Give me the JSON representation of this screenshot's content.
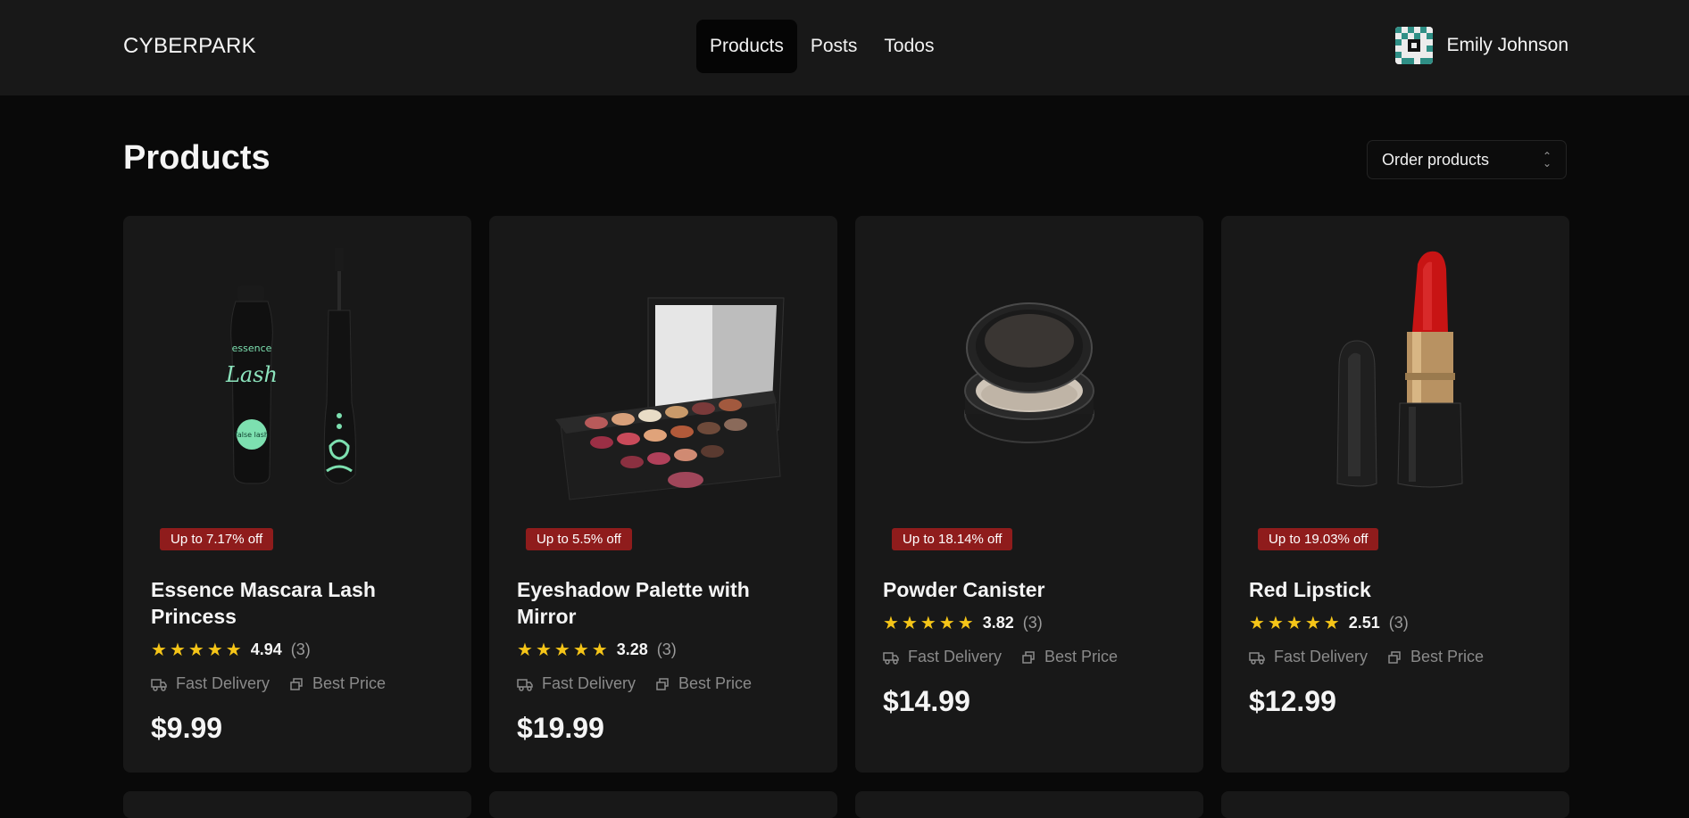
{
  "header": {
    "brand": "CYBERPARK",
    "nav": [
      {
        "label": "Products",
        "active": true
      },
      {
        "label": "Posts",
        "active": false
      },
      {
        "label": "Todos",
        "active": false
      }
    ],
    "user_name": "Emily Johnson"
  },
  "main": {
    "title": "Products",
    "order_select": {
      "label": "Order products"
    }
  },
  "products": [
    {
      "badge": "Up to 7.17% off",
      "title": "Essence Mascara Lash Princess",
      "rating": "4.94",
      "reviews": "(3)",
      "feature1": "Fast Delivery",
      "feature2": "Best Price",
      "price": "$9.99",
      "image": "mascara"
    },
    {
      "badge": "Up to 5.5% off",
      "title": "Eyeshadow Palette with Mirror",
      "rating": "3.28",
      "reviews": "(3)",
      "feature1": "Fast Delivery",
      "feature2": "Best Price",
      "price": "$19.99",
      "image": "eyeshadow-palette"
    },
    {
      "badge": "Up to 18.14% off",
      "title": "Powder Canister",
      "rating": "3.82",
      "reviews": "(3)",
      "feature1": "Fast Delivery",
      "feature2": "Best Price",
      "price": "$14.99",
      "image": "powder-compact"
    },
    {
      "badge": "Up to 19.03% off",
      "title": "Red Lipstick",
      "rating": "2.51",
      "reviews": "(3)",
      "feature1": "Fast Delivery",
      "feature2": "Best Price",
      "price": "$12.99",
      "image": "lipstick"
    }
  ],
  "colors": {
    "background": "#090909",
    "card": "#181818",
    "badge": "#8f1c1c",
    "star": "#f5c518"
  }
}
